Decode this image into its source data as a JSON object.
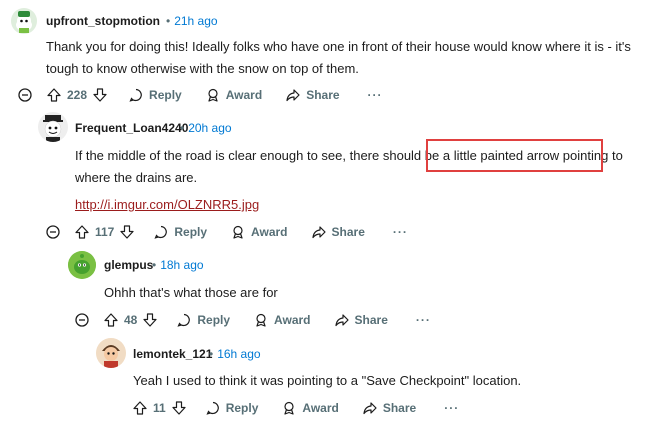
{
  "comments": [
    {
      "username": "upfront_stopmotion",
      "time": "21h ago",
      "text": "Thank you for doing this! Ideally folks who have one in front of their house would know where it is - it's tough to know otherwise with the snow on top of them.",
      "votes": "228"
    },
    {
      "username": "Frequent_Loan4240",
      "time": "20h ago",
      "text_before": "If the middle of the road is clear enough to see, there should be ",
      "text_highlight": "a little painted arrow pointing",
      "text_after": " to where the drains are.",
      "link": "http://i.imgur.com/OLZNRR5.jpg",
      "votes": "117"
    },
    {
      "username": "glempus",
      "time": "18h ago",
      "text": "Ohhh that's what those are for",
      "votes": "48"
    },
    {
      "username": "lemontek_121",
      "time": "16h ago",
      "text": "Yeah I used to think it was pointing to a \"Save Checkpoint\" location.",
      "votes": "11"
    }
  ],
  "actions": {
    "reply": "Reply",
    "award": "Award",
    "share": "Share",
    "more": "···"
  },
  "separator": "•",
  "colors": {
    "highlight": "#e0403f",
    "timestamp": "#0079d3",
    "link": "#9b1c1c"
  }
}
